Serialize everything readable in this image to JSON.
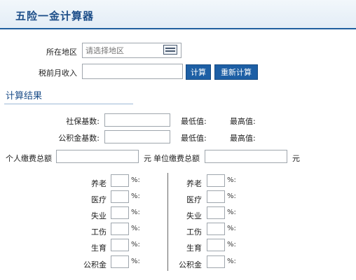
{
  "header": {
    "title": "五险一金计算器"
  },
  "form": {
    "region_label": "所在地区",
    "region_placeholder": "请选择地区",
    "income_label": "税前月收入",
    "calc_button": "计算",
    "recalc_button": "重新计算"
  },
  "results": {
    "title": "计算结果",
    "social_base_label": "社保基数:",
    "social_min_label": "最低值:",
    "social_max_label": "最高值:",
    "fund_base_label": "公积金基数:",
    "fund_min_label": "最低值:",
    "fund_max_label": "最高值:",
    "personal_total_label": "个人缴费总额",
    "personal_unit": "元",
    "company_total_label": "单位缴费总额",
    "company_unit": "元"
  },
  "rates": {
    "percent_symbol": "%:",
    "personal": [
      {
        "label": "养老"
      },
      {
        "label": "医疗"
      },
      {
        "label": "失业"
      },
      {
        "label": "工伤"
      },
      {
        "label": "生育"
      },
      {
        "label": "公积金"
      }
    ],
    "company": [
      {
        "label": "养老"
      },
      {
        "label": "医疗"
      },
      {
        "label": "失业"
      },
      {
        "label": "工伤"
      },
      {
        "label": "生育"
      },
      {
        "label": "公积金"
      }
    ]
  }
}
